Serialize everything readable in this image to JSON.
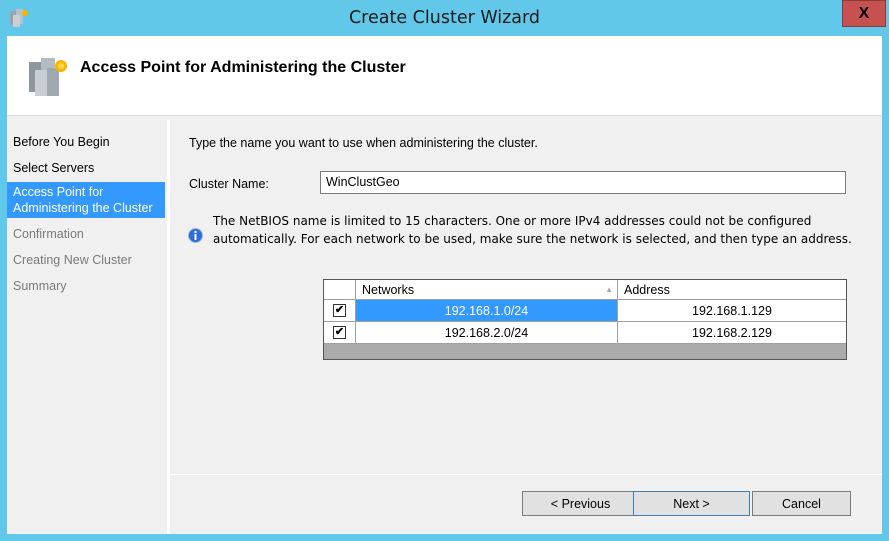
{
  "window": {
    "title": "Create Cluster Wizard",
    "close_label": "X",
    "app_icon": "cluster-servers-icon"
  },
  "header": {
    "title": "Access Point for Administering the Cluster",
    "icon": "cluster-servers-icon"
  },
  "sidebar": {
    "steps": [
      {
        "label": "Before You Begin",
        "state": "done"
      },
      {
        "label": "Select Servers",
        "state": "done"
      },
      {
        "label": "Access Point for Administering the Cluster",
        "state": "active"
      },
      {
        "label": "Confirmation",
        "state": "future"
      },
      {
        "label": "Creating New Cluster",
        "state": "future"
      },
      {
        "label": "Summary",
        "state": "future"
      }
    ]
  },
  "main": {
    "instruction": "Type the name you want to use when administering the cluster.",
    "cluster_name_label": "Cluster Name:",
    "cluster_name_value": "WinClustGeo",
    "info_icon": "info-icon",
    "info_text": "The NetBIOS name is limited to 15 characters.  One or more IPv4 addresses could not be configured automatically.  For each network to be used, make sure the network is selected, and then type an address.",
    "grid": {
      "columns": [
        "",
        "Networks",
        "Address"
      ],
      "sort_column": "Networks",
      "sort_direction": "ascending",
      "rows": [
        {
          "checked": true,
          "network": "192.168.1.0/24",
          "address": "192.168.1.129",
          "selected": true
        },
        {
          "checked": true,
          "network": "192.168.2.0/24",
          "address": "192.168.2.129",
          "selected": false
        }
      ]
    }
  },
  "footer": {
    "previous_label": "< Previous",
    "next_label": "Next >",
    "cancel_label": "Cancel"
  },
  "colors": {
    "frame": "#62c8ea",
    "selection": "#3399ff",
    "close_button": "#c75050"
  }
}
